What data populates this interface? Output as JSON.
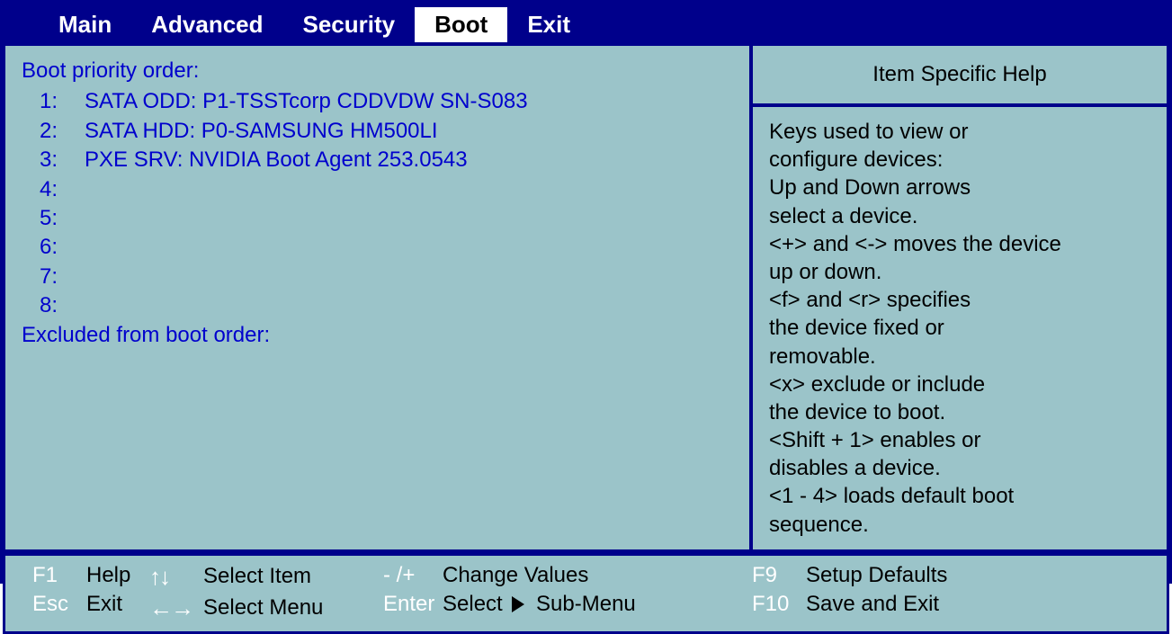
{
  "tabs": {
    "main": "Main",
    "advanced": "Advanced",
    "security": "Security",
    "boot": "Boot",
    "exit": "Exit",
    "active": "boot"
  },
  "main": {
    "boot_header": "Boot priority order:",
    "items": [
      {
        "num": "1:",
        "val": "SATA ODD: P1-TSSTcorp CDDVDW SN-S083"
      },
      {
        "num": "2:",
        "val": "SATA HDD: P0-SAMSUNG HM500LI"
      },
      {
        "num": "3:",
        "val": "PXE SRV: NVIDIA Boot Agent 253.0543"
      },
      {
        "num": "4:",
        "val": ""
      },
      {
        "num": "5:",
        "val": ""
      },
      {
        "num": "6:",
        "val": ""
      },
      {
        "num": "7:",
        "val": ""
      },
      {
        "num": "8:",
        "val": ""
      }
    ],
    "excluded_header": "Excluded from boot order:"
  },
  "help": {
    "title": "Item Specific Help",
    "lines": [
      "Keys used to view or",
      "configure devices:",
      "Up and Down arrows",
      "select a device.",
      "<+> and <-> moves the device",
      "up or down.",
      "<f> and <r> specifies",
      "the device fixed or",
      "removable.",
      "<x> exclude or include",
      "the device to boot.",
      "<Shift + 1> enables or",
      "disables a device.",
      "<1 - 4> loads default boot",
      "sequence."
    ]
  },
  "footer": {
    "f1": "F1",
    "f1_label": "Help",
    "esc": "Esc",
    "esc_label": "Exit",
    "updown": "↑↓",
    "updown_label": "Select Item",
    "leftright": "←→",
    "leftright_label": "Select Menu",
    "plusminus": "- /+",
    "plusminus_label": "Change Values",
    "enter": "Enter",
    "enter_label_a": "Select",
    "enter_label_b": "Sub-Menu",
    "f9": "F9",
    "f9_label": "Setup Defaults",
    "f10": "F10",
    "f10_label": "Save and Exit"
  }
}
